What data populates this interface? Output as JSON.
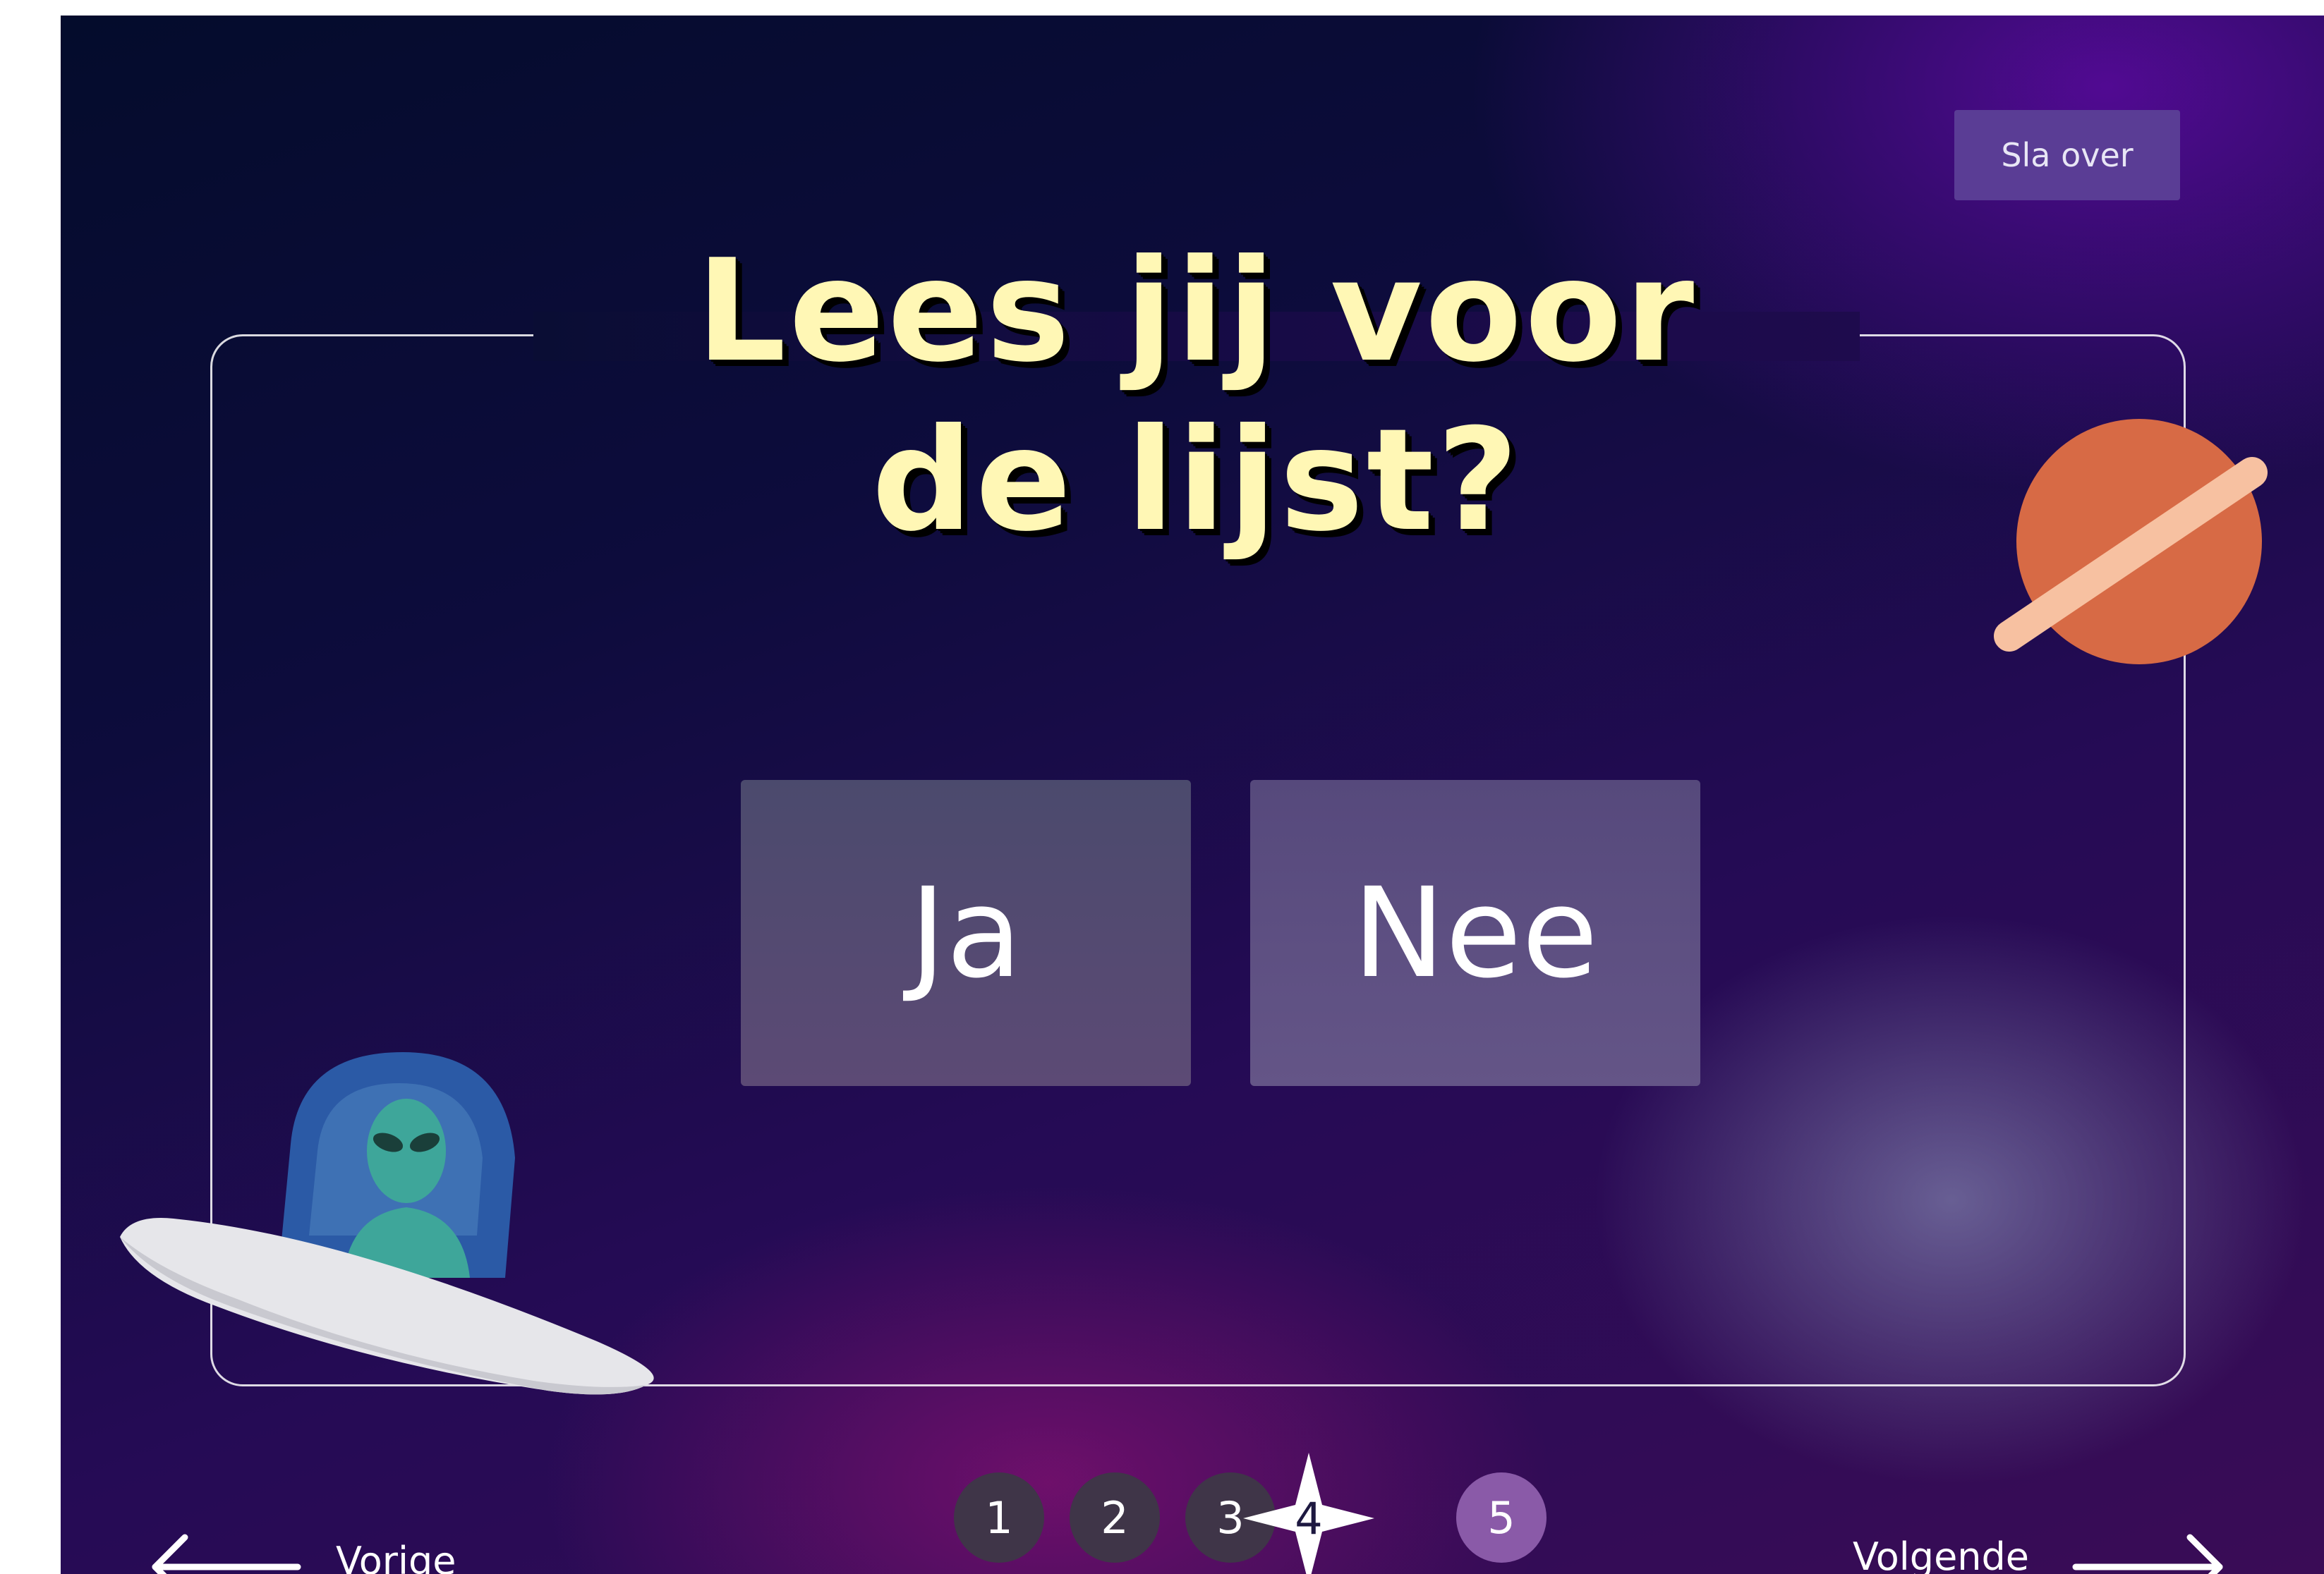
{
  "header": {
    "skip_label": "Sla over"
  },
  "question": {
    "line1": "Lees jij voor",
    "line2": "de lijst?"
  },
  "answers": [
    {
      "label": "Ja"
    },
    {
      "label": "Nee"
    }
  ],
  "pagination": {
    "pages": [
      "1",
      "2",
      "3",
      "4",
      "5"
    ],
    "current": "4"
  },
  "navigation": {
    "prev_label": "Vorige",
    "next_label": "Volgende"
  },
  "colors": {
    "title": "#fff7b5",
    "skip_button": "#5a3d95",
    "answer_button": "#56497c",
    "planet": "#d76a45",
    "planet_ring": "#f7c1a1",
    "alien": "#3ea69a"
  },
  "icons": [
    "planet-icon",
    "ufo-alien-icon",
    "star-icon",
    "arrow-left-icon",
    "arrow-right-icon"
  ]
}
